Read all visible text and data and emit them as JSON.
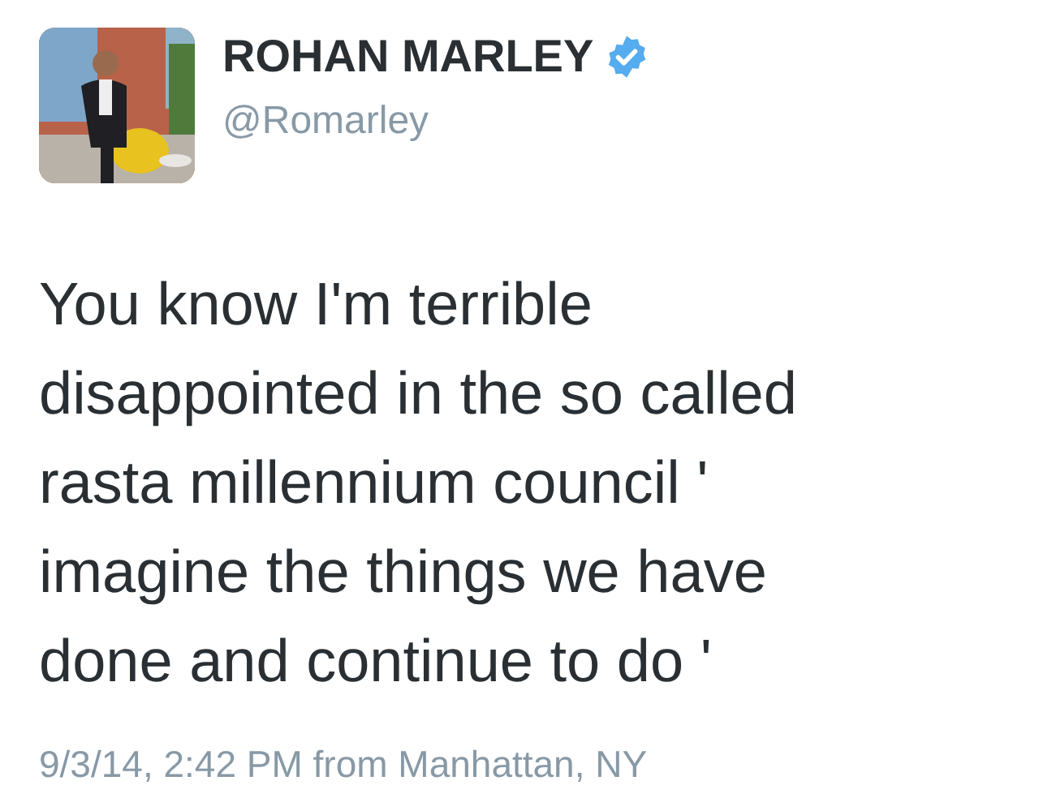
{
  "author": {
    "name": "ROHAN MARLEY",
    "verified": true,
    "handle": "@Romarley"
  },
  "tweet": {
    "text": "You know I'm terrible\ndisappointed in the so called\nrasta millennium council '\nimagine the things we have\ndone and continue to do '"
  },
  "meta": {
    "timestamp": "9/3/14, 2:42 PM from Manhattan, NY"
  }
}
